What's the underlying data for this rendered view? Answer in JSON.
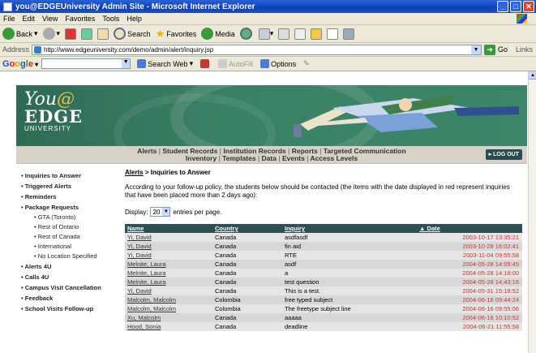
{
  "window": {
    "title": "you@EDGEUniversity Admin Site - Microsoft Internet Explorer"
  },
  "menu": [
    "File",
    "Edit",
    "View",
    "Favorites",
    "Tools",
    "Help"
  ],
  "toolbar": {
    "back": "Back",
    "search": "Search",
    "favorites": "Favorites",
    "media": "Media"
  },
  "address": {
    "label": "Address",
    "url": "http://www.edgeuniversity.com/demo/admin/alert/inquiry.jsp",
    "go": "Go",
    "links": "Links"
  },
  "google": {
    "search_web": "Search Web",
    "autofill": "AutoFill",
    "options": "Options"
  },
  "banner": {
    "you": "You",
    "at": "@",
    "edge": "EDGE",
    "university": "UNIVERSITY"
  },
  "nav": {
    "line1": [
      "Alerts",
      "Student Records",
      "Institution Records",
      "Reports",
      "Targeted Communication"
    ],
    "line2": [
      "Inventory",
      "Templates",
      "Data",
      "Events",
      "Access Levels"
    ],
    "logout": "LOG OUT"
  },
  "sidebar": {
    "items": [
      {
        "label": "Inquiries to Answer",
        "sub": false
      },
      {
        "label": "Triggered Alerts",
        "sub": false
      },
      {
        "label": "Reminders",
        "sub": false
      },
      {
        "label": "Package Requests",
        "sub": false
      },
      {
        "label": "GTA (Toronto)",
        "sub": true
      },
      {
        "label": "Rest of Ontario",
        "sub": true
      },
      {
        "label": "Rest of Canada",
        "sub": true
      },
      {
        "label": "International",
        "sub": true
      },
      {
        "label": "No Location Specified",
        "sub": true
      },
      {
        "label": "Alerts 4U",
        "sub": false
      },
      {
        "label": "Calls 4U",
        "sub": false
      },
      {
        "label": "Campus Visit Cancellation",
        "sub": false
      },
      {
        "label": "Feedback",
        "sub": false
      },
      {
        "label": "School Visits Follow-up",
        "sub": false
      }
    ]
  },
  "main": {
    "crumb_link": "Alerts",
    "crumb_rest": " > Inquiries to Answer",
    "intro": "According to your follow-up policy, the students below should be contacted (the items with the date displayed in red represent inquiries that have been placed more than 2 days ago):",
    "display_label": "Display:",
    "display_value": "20",
    "display_suffix": "entries per page.",
    "columns": {
      "name": "Name",
      "country": "Country",
      "inquiry": "Inquiry",
      "date": "Date",
      "date_arrow": "▲"
    },
    "rows": [
      {
        "name": "Yi, David",
        "country": "Canada",
        "inquiry": "asdfasdf",
        "date": "2003-10-17 13:35:21"
      },
      {
        "name": "Yi, David",
        "country": "Canada",
        "inquiry": "fin aid",
        "date": "2003-10-28 16:02:41"
      },
      {
        "name": "Yi, David",
        "country": "Canada",
        "inquiry": "RTE",
        "date": "2003-11-04 09:55:58"
      },
      {
        "name": "Melnite, Laura",
        "country": "Canada",
        "inquiry": "asdf",
        "date": "2004-05-28 14:09:45"
      },
      {
        "name": "Melnite, Laura",
        "country": "Canada",
        "inquiry": "a",
        "date": "2004-05-28 14:18:00"
      },
      {
        "name": "Melnite, Laura",
        "country": "Canada",
        "inquiry": "test question",
        "date": "2004-05-28 14:43:16"
      },
      {
        "name": "Yi, David",
        "country": "Canada",
        "inquiry": "This is a test.",
        "date": "2004-05-31 15:18:52"
      },
      {
        "name": "Malcolm, Malcolm",
        "country": "Colombia",
        "inquiry": "free typed subject",
        "date": "2004-06-16 09:44:24"
      },
      {
        "name": "Malcolm, Malcolm",
        "country": "Colombia",
        "inquiry": "The freetype subject line",
        "date": "2004-06-16 09:55:06"
      },
      {
        "name": "Xu, Malcolm",
        "country": "Canada",
        "inquiry": "aaaaa",
        "date": "2004-06-16 10:10:52"
      },
      {
        "name": "Hood, Sonia",
        "country": "Canada",
        "inquiry": "deadline",
        "date": "2004-06-21 11:55:58"
      }
    ]
  }
}
